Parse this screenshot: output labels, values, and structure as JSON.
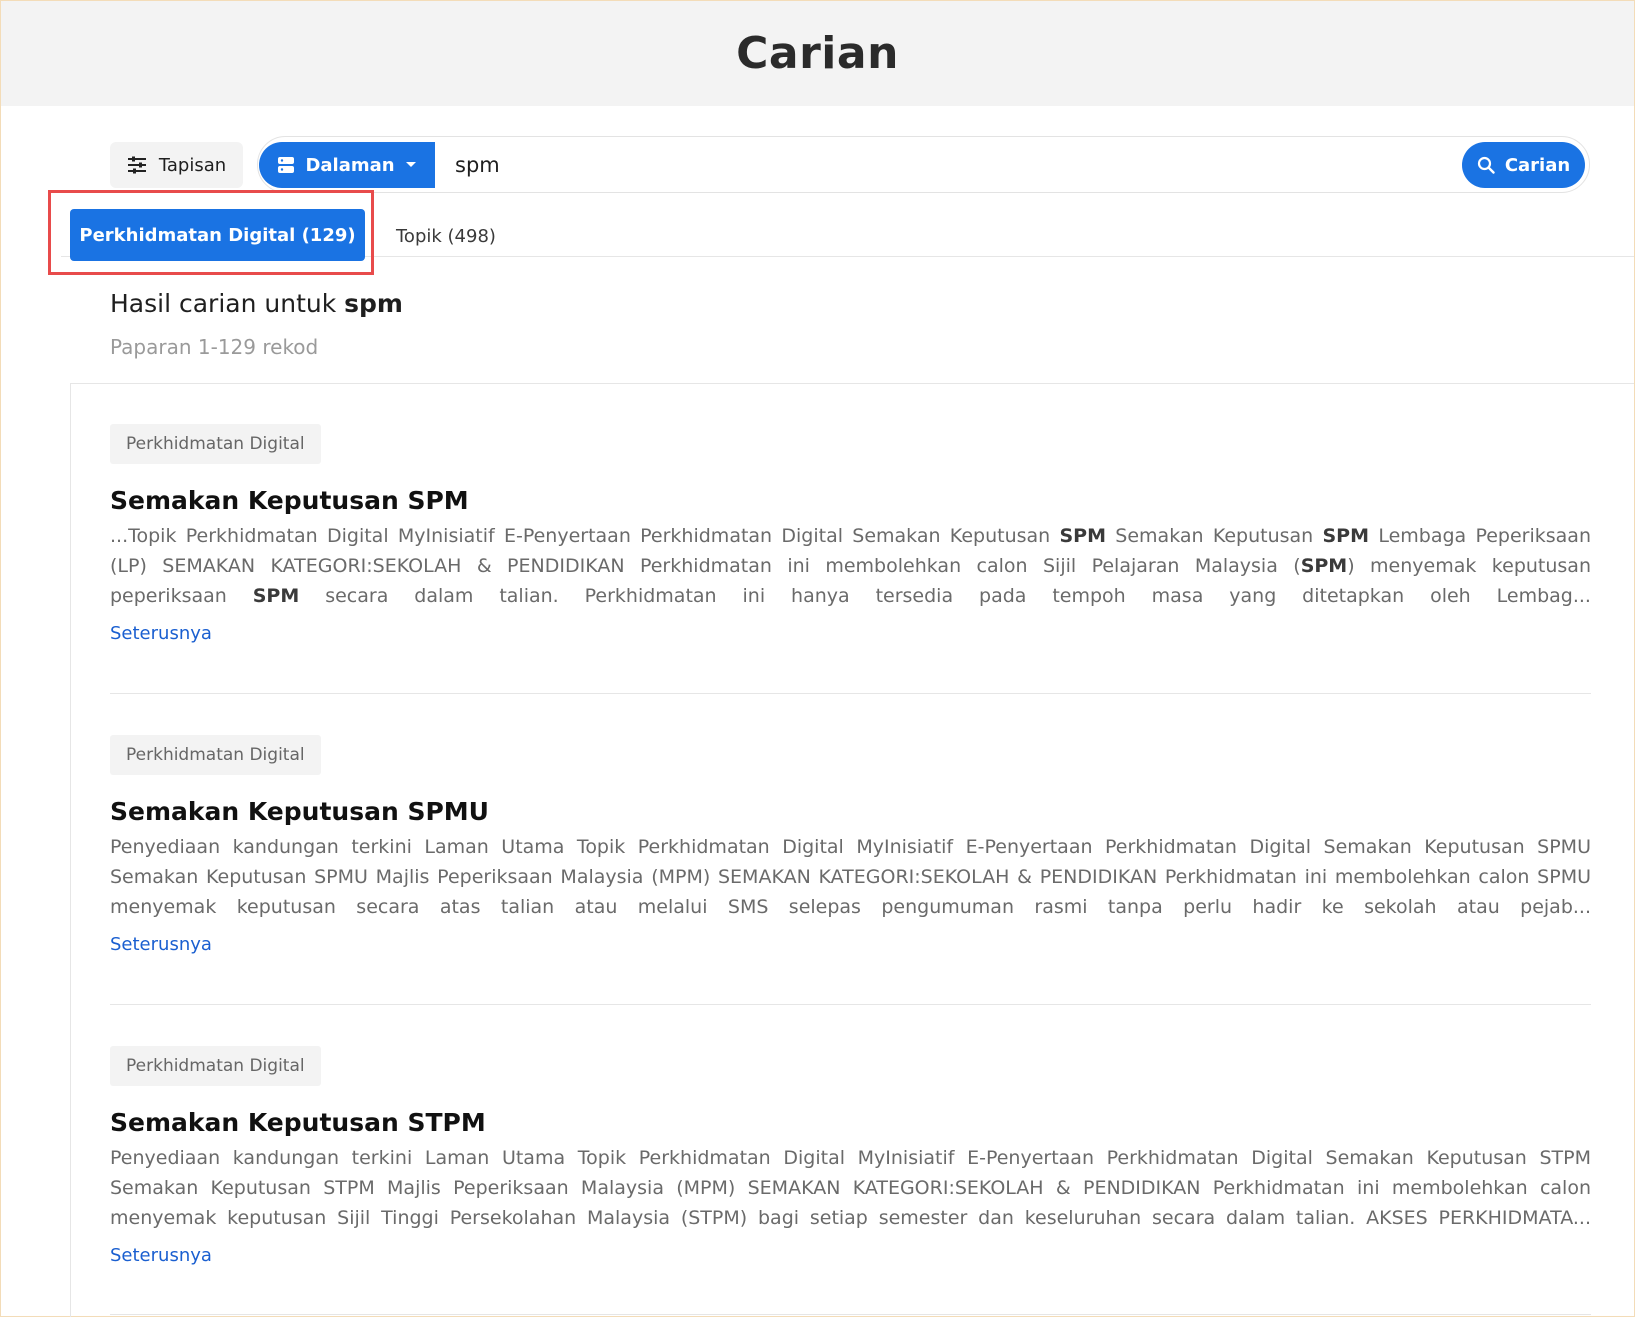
{
  "header": {
    "title": "Carian"
  },
  "search": {
    "filter_label": "Tapisan",
    "scope_label": "Dalaman",
    "query": "spm",
    "submit_label": "Carian"
  },
  "tabs": [
    {
      "label": "Perkhidmatan Digital (129)",
      "active": true
    },
    {
      "label": "Topik (498)",
      "active": false
    }
  ],
  "results_header": {
    "prefix": "Hasil carian untuk ",
    "query": "spm",
    "count_text": "Paparan 1-129 rekod"
  },
  "results": [
    {
      "category": "Perkhidmatan Digital",
      "title": "Semakan Keputusan SPM",
      "snippet_parts": [
        {
          "t": "...Topik Perkhidmatan Digital MyInisiatif E-Penyertaan Perkhidmatan Digital Semakan Keputusan "
        },
        {
          "t": "SPM",
          "b": true
        },
        {
          "t": " Semakan Keputusan "
        },
        {
          "t": "SPM",
          "b": true
        },
        {
          "t": " Lembaga Peperiksaan (LP) SEMAKAN KATEGORI:SEKOLAH & PENDIDIKAN Perkhidmatan ini membolehkan calon Sijil Pelajaran Malaysia ("
        },
        {
          "t": "SPM",
          "b": true
        },
        {
          "t": ") menyemak keputusan peperiksaan "
        },
        {
          "t": "SPM",
          "b": true
        },
        {
          "t": " secara dalam talian. Perkhidmatan ini hanya tersedia pada tempoh masa yang ditetapkan oleh Lembag..."
        }
      ],
      "link": "Seterusnya"
    },
    {
      "category": "Perkhidmatan Digital",
      "title": "Semakan Keputusan SPMU",
      "snippet_parts": [
        {
          "t": "Penyediaan kandungan terkini Laman Utama Topik Perkhidmatan Digital MyInisiatif E-Penyertaan Perkhidmatan Digital Semakan Keputusan SPMU Semakan Keputusan SPMU Majlis Peperiksaan Malaysia (MPM) SEMAKAN KATEGORI:SEKOLAH & PENDIDIKAN Perkhidmatan ini membolehkan calon SPMU menyemak keputusan secara atas talian atau melalui SMS selepas pengumuman rasmi tanpa perlu hadir ke sekolah atau pejab..."
        }
      ],
      "link": "Seterusnya"
    },
    {
      "category": "Perkhidmatan Digital",
      "title": "Semakan Keputusan STPM",
      "snippet_parts": [
        {
          "t": "Penyediaan kandungan terkini Laman Utama Topik Perkhidmatan Digital MyInisiatif E-Penyertaan Perkhidmatan Digital Semakan Keputusan STPM Semakan Keputusan STPM Majlis Peperiksaan Malaysia (MPM) SEMAKAN KATEGORI:SEKOLAH & PENDIDIKAN Perkhidmatan ini membolehkan calon menyemak keputusan Sijil Tinggi Persekolahan Malaysia (STPM) bagi setiap semester dan keseluruhan secara dalam talian. AKSES PERKHIDMATA..."
        }
      ],
      "link": "Seterusnya"
    }
  ],
  "colors": {
    "accent": "#1a73e3",
    "highlight_border": "#e84b4b",
    "link": "#1a5fd0"
  }
}
